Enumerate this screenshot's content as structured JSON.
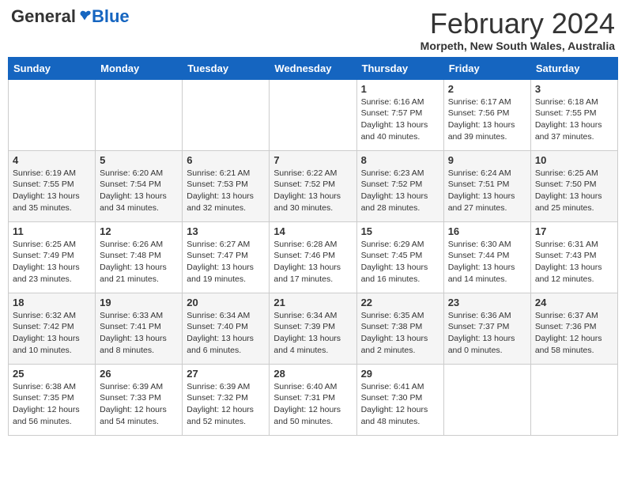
{
  "logo": {
    "general": "General",
    "blue": "Blue"
  },
  "header": {
    "month": "February 2024",
    "location": "Morpeth, New South Wales, Australia"
  },
  "weekdays": [
    "Sunday",
    "Monday",
    "Tuesday",
    "Wednesday",
    "Thursday",
    "Friday",
    "Saturday"
  ],
  "weeks": [
    [
      {
        "day": "",
        "info": ""
      },
      {
        "day": "",
        "info": ""
      },
      {
        "day": "",
        "info": ""
      },
      {
        "day": "",
        "info": ""
      },
      {
        "day": "1",
        "info": "Sunrise: 6:16 AM\nSunset: 7:57 PM\nDaylight: 13 hours and 40 minutes."
      },
      {
        "day": "2",
        "info": "Sunrise: 6:17 AM\nSunset: 7:56 PM\nDaylight: 13 hours and 39 minutes."
      },
      {
        "day": "3",
        "info": "Sunrise: 6:18 AM\nSunset: 7:55 PM\nDaylight: 13 hours and 37 minutes."
      }
    ],
    [
      {
        "day": "4",
        "info": "Sunrise: 6:19 AM\nSunset: 7:55 PM\nDaylight: 13 hours and 35 minutes."
      },
      {
        "day": "5",
        "info": "Sunrise: 6:20 AM\nSunset: 7:54 PM\nDaylight: 13 hours and 34 minutes."
      },
      {
        "day": "6",
        "info": "Sunrise: 6:21 AM\nSunset: 7:53 PM\nDaylight: 13 hours and 32 minutes."
      },
      {
        "day": "7",
        "info": "Sunrise: 6:22 AM\nSunset: 7:52 PM\nDaylight: 13 hours and 30 minutes."
      },
      {
        "day": "8",
        "info": "Sunrise: 6:23 AM\nSunset: 7:52 PM\nDaylight: 13 hours and 28 minutes."
      },
      {
        "day": "9",
        "info": "Sunrise: 6:24 AM\nSunset: 7:51 PM\nDaylight: 13 hours and 27 minutes."
      },
      {
        "day": "10",
        "info": "Sunrise: 6:25 AM\nSunset: 7:50 PM\nDaylight: 13 hours and 25 minutes."
      }
    ],
    [
      {
        "day": "11",
        "info": "Sunrise: 6:25 AM\nSunset: 7:49 PM\nDaylight: 13 hours and 23 minutes."
      },
      {
        "day": "12",
        "info": "Sunrise: 6:26 AM\nSunset: 7:48 PM\nDaylight: 13 hours and 21 minutes."
      },
      {
        "day": "13",
        "info": "Sunrise: 6:27 AM\nSunset: 7:47 PM\nDaylight: 13 hours and 19 minutes."
      },
      {
        "day": "14",
        "info": "Sunrise: 6:28 AM\nSunset: 7:46 PM\nDaylight: 13 hours and 17 minutes."
      },
      {
        "day": "15",
        "info": "Sunrise: 6:29 AM\nSunset: 7:45 PM\nDaylight: 13 hours and 16 minutes."
      },
      {
        "day": "16",
        "info": "Sunrise: 6:30 AM\nSunset: 7:44 PM\nDaylight: 13 hours and 14 minutes."
      },
      {
        "day": "17",
        "info": "Sunrise: 6:31 AM\nSunset: 7:43 PM\nDaylight: 13 hours and 12 minutes."
      }
    ],
    [
      {
        "day": "18",
        "info": "Sunrise: 6:32 AM\nSunset: 7:42 PM\nDaylight: 13 hours and 10 minutes."
      },
      {
        "day": "19",
        "info": "Sunrise: 6:33 AM\nSunset: 7:41 PM\nDaylight: 13 hours and 8 minutes."
      },
      {
        "day": "20",
        "info": "Sunrise: 6:34 AM\nSunset: 7:40 PM\nDaylight: 13 hours and 6 minutes."
      },
      {
        "day": "21",
        "info": "Sunrise: 6:34 AM\nSunset: 7:39 PM\nDaylight: 13 hours and 4 minutes."
      },
      {
        "day": "22",
        "info": "Sunrise: 6:35 AM\nSunset: 7:38 PM\nDaylight: 13 hours and 2 minutes."
      },
      {
        "day": "23",
        "info": "Sunrise: 6:36 AM\nSunset: 7:37 PM\nDaylight: 13 hours and 0 minutes."
      },
      {
        "day": "24",
        "info": "Sunrise: 6:37 AM\nSunset: 7:36 PM\nDaylight: 12 hours and 58 minutes."
      }
    ],
    [
      {
        "day": "25",
        "info": "Sunrise: 6:38 AM\nSunset: 7:35 PM\nDaylight: 12 hours and 56 minutes."
      },
      {
        "day": "26",
        "info": "Sunrise: 6:39 AM\nSunset: 7:33 PM\nDaylight: 12 hours and 54 minutes."
      },
      {
        "day": "27",
        "info": "Sunrise: 6:39 AM\nSunset: 7:32 PM\nDaylight: 12 hours and 52 minutes."
      },
      {
        "day": "28",
        "info": "Sunrise: 6:40 AM\nSunset: 7:31 PM\nDaylight: 12 hours and 50 minutes."
      },
      {
        "day": "29",
        "info": "Sunrise: 6:41 AM\nSunset: 7:30 PM\nDaylight: 12 hours and 48 minutes."
      },
      {
        "day": "",
        "info": ""
      },
      {
        "day": "",
        "info": ""
      }
    ]
  ]
}
